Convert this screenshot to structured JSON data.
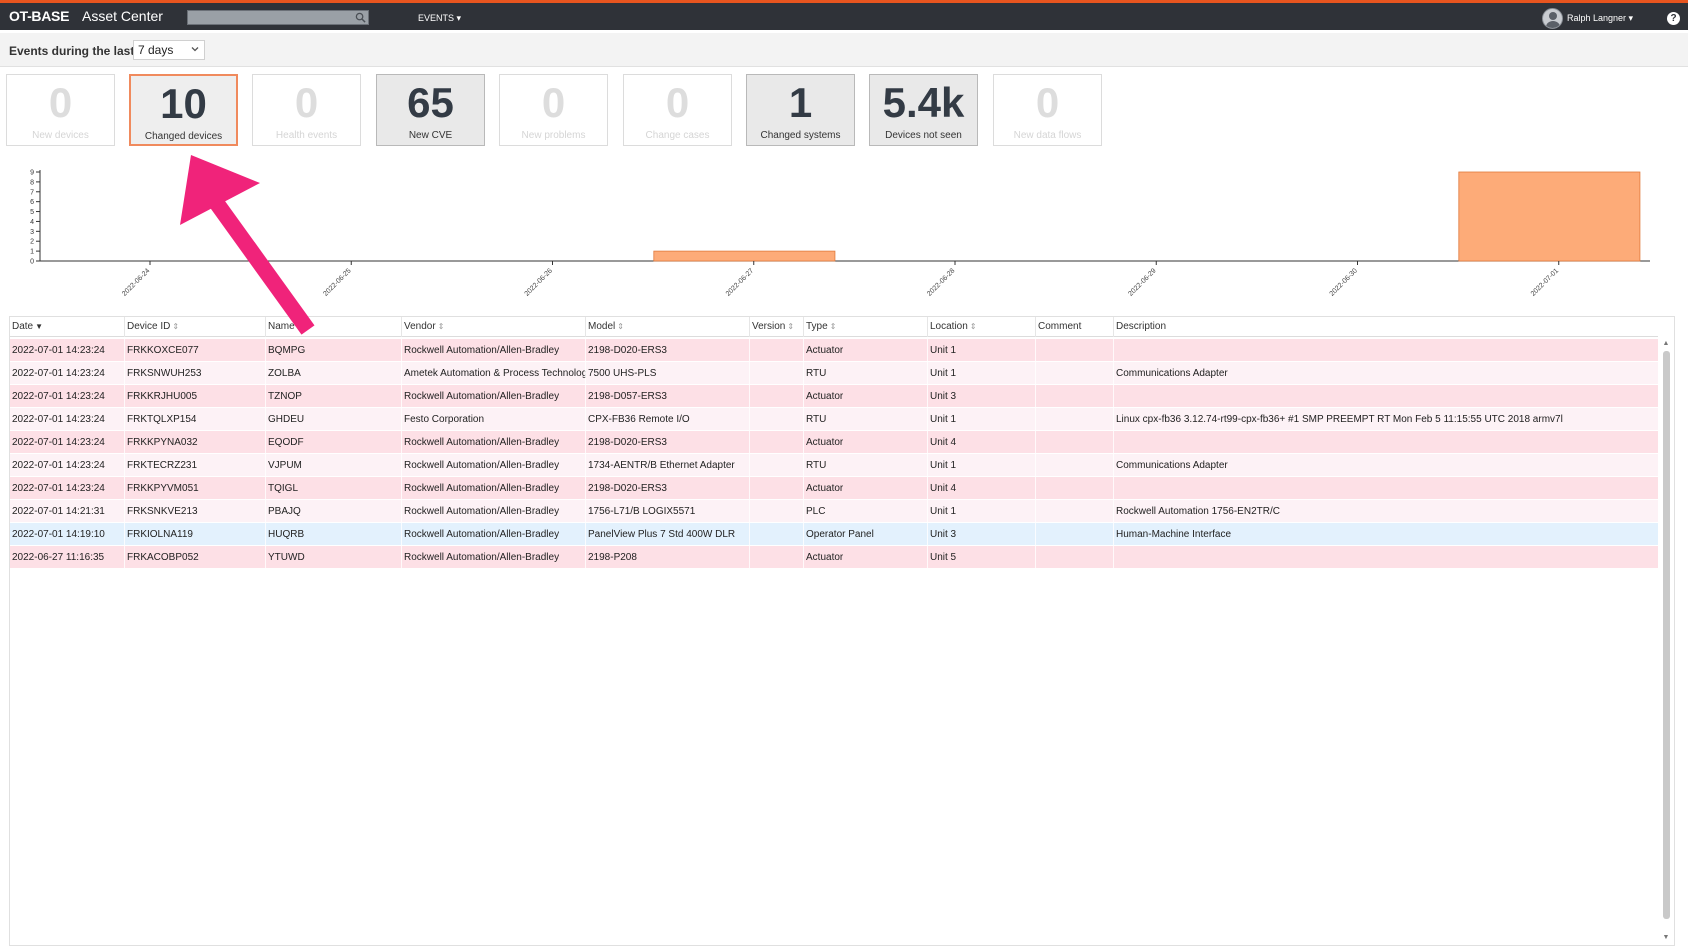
{
  "header": {
    "logo": "OT-BASE",
    "app_title": "Asset Center",
    "search_placeholder": "",
    "menu_events": "EVENTS ▾",
    "user_name": "Ralph Langner ▾",
    "help": "?"
  },
  "filter": {
    "label": "Events during the last",
    "selected": "7 days"
  },
  "cards": [
    {
      "value": "0",
      "label": "New devices"
    },
    {
      "value": "10",
      "label": "Changed devices"
    },
    {
      "value": "0",
      "label": "Health events"
    },
    {
      "value": "65",
      "label": "New CVE"
    },
    {
      "value": "0",
      "label": "New problems"
    },
    {
      "value": "0",
      "label": "Change cases"
    },
    {
      "value": "1",
      "label": "Changed systems"
    },
    {
      "value": "5.4k",
      "label": "Devices not seen"
    },
    {
      "value": "0",
      "label": "New data flows"
    }
  ],
  "chart_data": {
    "type": "bar",
    "categories": [
      "2022-06-24",
      "2022-06-25",
      "2022-06-26",
      "2022-06-27",
      "2022-06-28",
      "2022-06-29",
      "2022-06-30",
      "2022-07-01"
    ],
    "values": [
      0,
      0,
      0,
      1,
      0,
      0,
      0,
      9
    ],
    "title": "",
    "xlabel": "",
    "ylabel": "",
    "ylim": [
      0,
      9
    ],
    "yticks": [
      0,
      1,
      2,
      3,
      4,
      5,
      6,
      7,
      8,
      9
    ],
    "bar_color": "#fdab78",
    "grid": false
  },
  "table": {
    "columns": [
      "Date",
      "Device ID",
      "Name",
      "Vendor",
      "Model",
      "Version",
      "Type",
      "Location",
      "Comment",
      "Description"
    ],
    "rows": [
      {
        "style": "pink",
        "cells": [
          "2022-07-01 14:23:24",
          "FRKKOXCE077",
          "BQMPG",
          "Rockwell Automation/Allen-Bradley",
          "2198-D020-ERS3",
          "",
          "Actuator",
          "Unit 1",
          "",
          ""
        ]
      },
      {
        "style": "light",
        "cells": [
          "2022-07-01 14:23:24",
          "FRKSNWUH253",
          "ZOLBA",
          "Ametek Automation & Process Technologie",
          "7500 UHS-PLS",
          "",
          "RTU",
          "Unit 1",
          "",
          "Communications Adapter"
        ]
      },
      {
        "style": "pink",
        "cells": [
          "2022-07-01 14:23:24",
          "FRKKRJHU005",
          "TZNOP",
          "Rockwell Automation/Allen-Bradley",
          "2198-D057-ERS3",
          "",
          "Actuator",
          "Unit 3",
          "",
          ""
        ]
      },
      {
        "style": "light",
        "cells": [
          "2022-07-01 14:23:24",
          "FRKTQLXP154",
          "GHDEU",
          "Festo Corporation",
          "CPX-FB36 Remote I/O",
          "",
          "RTU",
          "Unit 1",
          "",
          "Linux cpx-fb36 3.12.74-rt99-cpx-fb36+ #1 SMP PREEMPT RT Mon Feb 5 11:15:55 UTC 2018 armv7l"
        ]
      },
      {
        "style": "pink",
        "cells": [
          "2022-07-01 14:23:24",
          "FRKKPYNA032",
          "EQODF",
          "Rockwell Automation/Allen-Bradley",
          "2198-D020-ERS3",
          "",
          "Actuator",
          "Unit 4",
          "",
          ""
        ]
      },
      {
        "style": "light",
        "cells": [
          "2022-07-01 14:23:24",
          "FRKTECRZ231",
          "VJPUM",
          "Rockwell Automation/Allen-Bradley",
          "1734-AENTR/B Ethernet Adapter",
          "",
          "RTU",
          "Unit 1",
          "",
          "Communications Adapter"
        ]
      },
      {
        "style": "pink",
        "cells": [
          "2022-07-01 14:23:24",
          "FRKKPYVM051",
          "TQIGL",
          "Rockwell Automation/Allen-Bradley",
          "2198-D020-ERS3",
          "",
          "Actuator",
          "Unit 4",
          "",
          ""
        ]
      },
      {
        "style": "light",
        "cells": [
          "2022-07-01 14:21:31",
          "FRKSNKVE213",
          "PBAJQ",
          "Rockwell Automation/Allen-Bradley",
          "1756-L71/B LOGIX5571",
          "",
          "PLC",
          "Unit 1",
          "",
          "Rockwell Automation 1756-EN2TR/C"
        ]
      },
      {
        "style": "blue",
        "cells": [
          "2022-07-01 14:19:10",
          "FRKIOLNA119",
          "HUQRB",
          "Rockwell Automation/Allen-Bradley",
          "PanelView Plus 7 Std 400W DLR",
          "",
          "Operator Panel",
          "Unit 3",
          "",
          "Human-Machine Interface"
        ]
      },
      {
        "style": "pink",
        "cells": [
          "2022-06-27 11:16:35",
          "FRKACOBP052",
          "YTUWD",
          "Rockwell Automation/Allen-Bradley",
          "2198-P208",
          "",
          "Actuator",
          "Unit 5",
          "",
          ""
        ]
      }
    ]
  },
  "colors": {
    "topbar": "#2f3238",
    "accent": "#e8551f",
    "arrow": "#f0237a",
    "row_pink": "#fde0e6",
    "row_light": "#fdf2f6",
    "row_blue": "#e3f1fd"
  }
}
